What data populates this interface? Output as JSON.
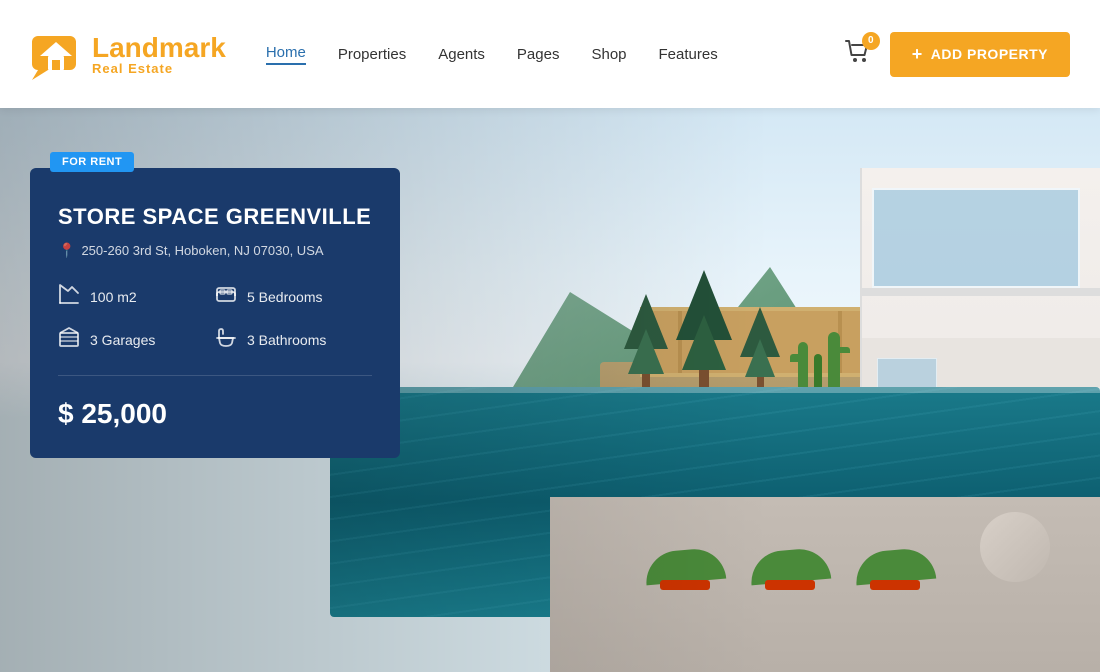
{
  "site": {
    "logo_brand": "Land",
    "logo_brand_highlight": "mark",
    "logo_sub": "Real Estate"
  },
  "nav": {
    "items": [
      {
        "label": "Home",
        "active": true
      },
      {
        "label": "Properties",
        "active": false
      },
      {
        "label": "Agents",
        "active": false
      },
      {
        "label": "Pages",
        "active": false
      },
      {
        "label": "Shop",
        "active": false
      },
      {
        "label": "Features",
        "active": false
      }
    ],
    "cart_count": "0",
    "add_property_label": "ADD PROPERTY"
  },
  "property": {
    "badge": "FOR RENT",
    "title": "STORE SPACE GREENVILLE",
    "address": "250-260 3rd St, Hoboken, NJ 07030, USA",
    "features": [
      {
        "icon": "area",
        "label": "100 m2"
      },
      {
        "icon": "bed",
        "label": "5 Bedrooms"
      },
      {
        "icon": "garage",
        "label": "3 Garages"
      },
      {
        "icon": "bath",
        "label": "3 Bathrooms"
      }
    ],
    "price_prefix": "$",
    "price": "25,000"
  },
  "colors": {
    "accent_orange": "#f5a623",
    "nav_blue": "#2a6fad",
    "card_bg": "#1a3a6b",
    "badge_blue": "#2196F3"
  }
}
